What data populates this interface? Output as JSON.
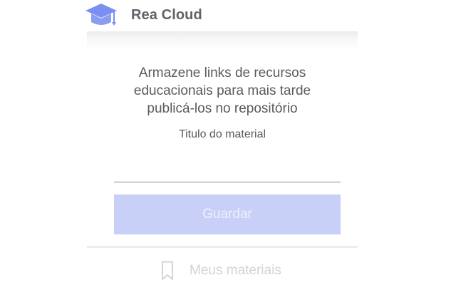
{
  "app": {
    "title": "Rea Cloud",
    "logo_icon": "graduation-cap-icon",
    "logo_color": "#7b8ff0"
  },
  "main": {
    "description_lines": [
      "Armazene links de recursos",
      "educacionais para mais tarde",
      "publicá-los no repositório"
    ],
    "field_label": "Titulo do material",
    "title_input": {
      "value": "",
      "placeholder": ""
    },
    "save_button_label": "Guardar",
    "save_button_color": "#c8d0f8"
  },
  "footer": {
    "nav_label": "Meus materiais",
    "nav_icon": "bookmark-icon"
  }
}
